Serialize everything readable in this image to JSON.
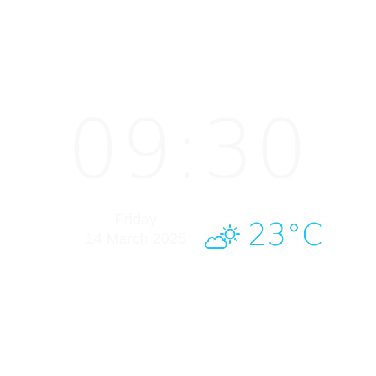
{
  "clock": {
    "time": "09:30"
  },
  "date": {
    "day": "Friday",
    "date": "14 March 2025"
  },
  "weather": {
    "icon": "partly-cloudy-icon",
    "temperature": "23°C"
  },
  "colors": {
    "background": "#ffffff",
    "accent": "#1ec2f5",
    "faint_text": "#f8f8f8"
  }
}
